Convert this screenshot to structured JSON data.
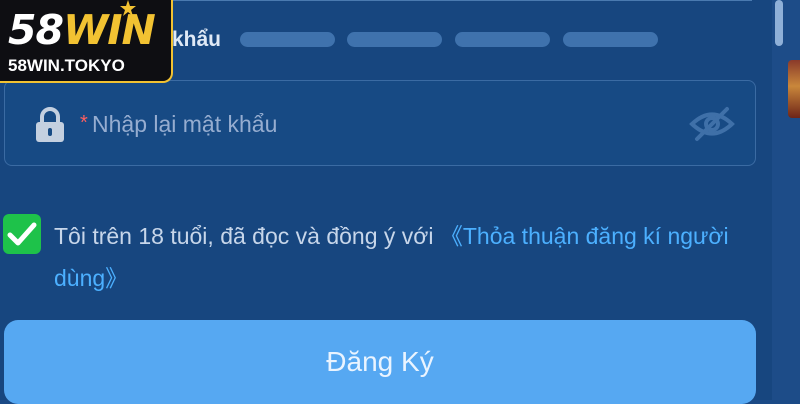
{
  "logo": {
    "brand_number": "58",
    "brand_word": "WIN",
    "domain": "58WIN.TOKYO"
  },
  "password_strength": {
    "label": "khẩu",
    "bar_count": 4
  },
  "confirm_password": {
    "required_marker": "*",
    "placeholder": "Nhập lại mật khẩu"
  },
  "agreement": {
    "checked": true,
    "text": "Tôi trên 18 tuổi, đã đọc và đồng ý với ",
    "link": "《Thỏa thuận đăng kí người dùng》"
  },
  "register_button": {
    "label": "Đăng Ký"
  },
  "icons": {
    "lock": "lock-icon",
    "eye": "eye-slash-icon",
    "check": "check-icon",
    "star": "star-icon"
  },
  "colors": {
    "background": "#17467f",
    "accent_button": "#56a8f2",
    "link": "#4cb0ff",
    "checkbox": "#1ec24a",
    "logo_gold": "#f2c232"
  }
}
